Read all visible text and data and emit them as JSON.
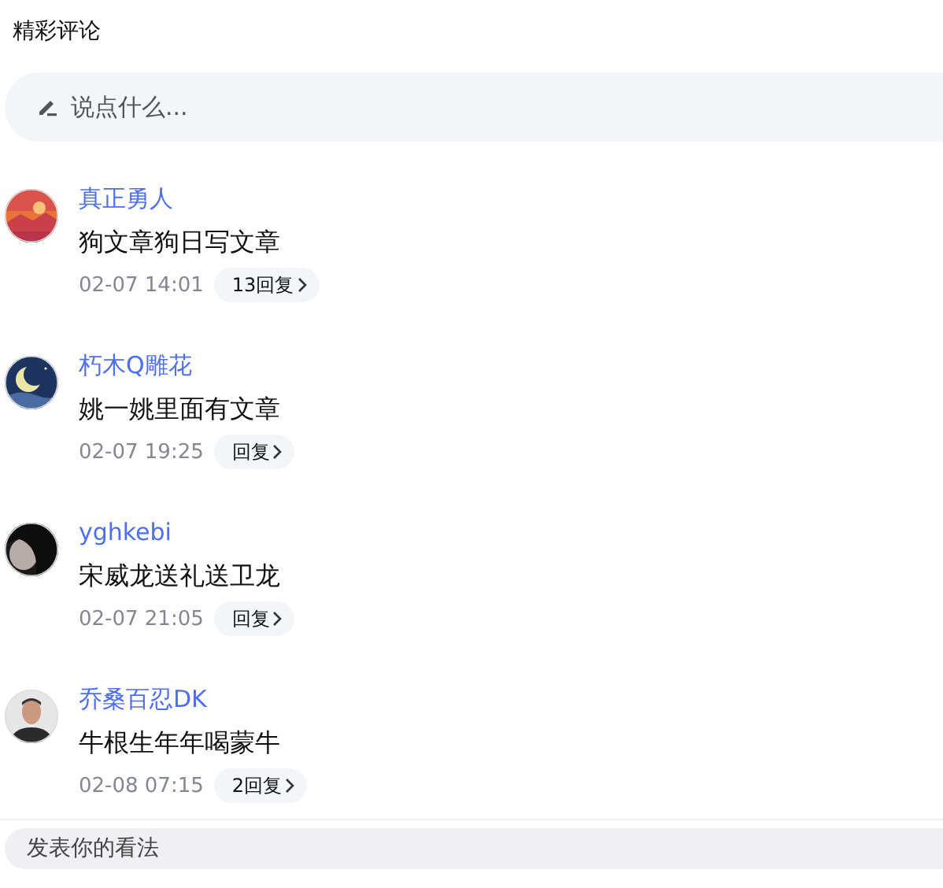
{
  "title": "精彩评论",
  "comment_input": {
    "placeholder": "说点什么..."
  },
  "comments": [
    {
      "name": "真正勇人",
      "text": "狗文章狗日写文章",
      "time": "02-07 14:01",
      "replies": "13回复"
    },
    {
      "name": "朽木Q雕花",
      "text": "姚一姚里面有文章",
      "time": "02-07 19:25",
      "replies": "回复"
    },
    {
      "name": "yghkebi",
      "text": "宋威龙送礼送卫龙",
      "time": "02-07 21:05",
      "replies": "回复"
    },
    {
      "name": "乔桑百忍DK",
      "text": "牛根生年年喝蒙牛",
      "time": "02-08 07:15",
      "replies": "2回复"
    }
  ],
  "bottom_bar": {
    "placeholder": "发表你的看法"
  }
}
